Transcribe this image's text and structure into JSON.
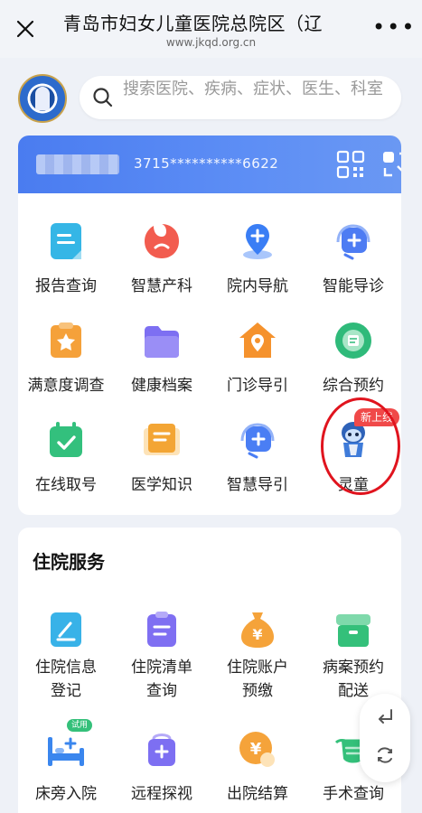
{
  "header": {
    "title": "青岛市妇女儿童医院总院区（辽",
    "url": "www.jkqd.org.cn",
    "close_icon": "close-icon",
    "more_icon": "more-icon"
  },
  "search": {
    "placeholder": "搜索医院、疾病、症状、医生、科室",
    "icon": "search-icon"
  },
  "card": {
    "masked_number": "3715**********6622",
    "icons": [
      "qr-code-icon",
      "scan-icon"
    ]
  },
  "services": [
    {
      "label": "报告查询",
      "icon": "report-icon",
      "color": "#35b6e6"
    },
    {
      "label": "智慧产科",
      "icon": "obstetrics-icon",
      "color": "#f25c4f"
    },
    {
      "label": "院内导航",
      "icon": "navigation-icon",
      "color": "#3a7ef5"
    },
    {
      "label": "智能导诊",
      "icon": "smart-guide-icon",
      "color": "#4d7cf3"
    },
    {
      "label": "满意度调查",
      "icon": "survey-icon",
      "color": "#f5a13a"
    },
    {
      "label": "健康档案",
      "icon": "folder-icon",
      "color": "#7d6ff2"
    },
    {
      "label": "门诊导引",
      "icon": "home-location-icon",
      "color": "#f5922d"
    },
    {
      "label": "综合预约",
      "icon": "appointment-icon",
      "color": "#2fba7a"
    },
    {
      "label": "在线取号",
      "icon": "calendar-check-icon",
      "color": "#33c07d"
    },
    {
      "label": "医学知识",
      "icon": "book-icon",
      "color": "#f3a534"
    },
    {
      "label": "智慧导引",
      "icon": "headset-icon",
      "color": "#4a7ef4"
    },
    {
      "label": "灵童",
      "icon": "mascot-icon",
      "color": "#3f7bd9"
    }
  ],
  "new_badge": "新上线",
  "inpatient": {
    "heading": "住院服务",
    "items": [
      {
        "label": "住院信息\n登记",
        "icon": "edit-icon",
        "color": "#38b2e8"
      },
      {
        "label": "住院清单\n查询",
        "icon": "list-icon",
        "color": "#7f6ff2"
      },
      {
        "label": "住院账户\n预缴",
        "icon": "money-bag-icon",
        "color": "#f5a33a"
      },
      {
        "label": "病案预约\n配送",
        "icon": "box-icon",
        "color": "#34c07a"
      },
      {
        "label": "床旁入院",
        "icon": "bed-icon",
        "color": "#3a86ee"
      },
      {
        "label": "远程探视",
        "icon": "visit-icon",
        "color": "#7d6ff2"
      },
      {
        "label": "出院结算",
        "icon": "settlement-icon",
        "color": "#f5a33a"
      },
      {
        "label": "手术查询",
        "icon": "surgery-mask-icon",
        "color": "#34c07a"
      }
    ],
    "trial_badge": "试用"
  },
  "floating_tools": [
    "back-icon",
    "refresh-icon"
  ]
}
